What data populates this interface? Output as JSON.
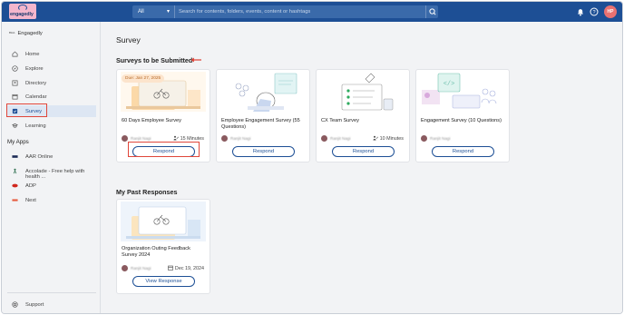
{
  "app": {
    "logo_text": "engagedly",
    "search": {
      "scope": "All",
      "placeholder": "Search for contents, folders, events, content or hashtags"
    },
    "user_initials": "HP"
  },
  "sidebar": {
    "company": "Engagedly",
    "company_mini": "ᴱᴺᴳᴬ",
    "items": [
      {
        "label": "Home",
        "icon": "home-icon"
      },
      {
        "label": "Explore",
        "icon": "compass-icon"
      },
      {
        "label": "Directory",
        "icon": "directory-icon"
      },
      {
        "label": "Calendar",
        "icon": "calendar-icon"
      },
      {
        "label": "Survey",
        "icon": "survey-icon",
        "active": true
      },
      {
        "label": "Learning",
        "icon": "learning-icon"
      }
    ],
    "my_apps_title": "My Apps",
    "apps": [
      {
        "label": "AAR Online",
        "icon": "aar-icon"
      },
      {
        "label": "Accolade - Free help with health ...",
        "icon": "accolade-icon"
      },
      {
        "label": "ADP",
        "icon": "adp-icon"
      },
      {
        "label": "Next",
        "icon": "next-icon"
      }
    ],
    "support": "Support"
  },
  "main": {
    "page_title": "Survey",
    "to_submit_title": "Surveys to be Submitted",
    "past_title": "My Past Responses",
    "surveys": [
      {
        "due": "Due: Jan 27, 2025",
        "title": "60 Days Employee Survey",
        "person": "Ranjit Nagi",
        "duration": "15 Minutes",
        "button": "Respond"
      },
      {
        "title": "Employee Engagement Survey (55 Questions)",
        "person": "Ranjit Nagi",
        "duration": "",
        "button": "Respond"
      },
      {
        "title": "CX Team Survey",
        "person": "Ranjit Nagi",
        "duration": "10 Minutes",
        "button": "Respond"
      },
      {
        "title": "Engagement Survey (10 Questions)",
        "person": "Ranjit Nagi",
        "duration": "",
        "button": "Respond"
      }
    ],
    "past": [
      {
        "title": "Organization Outing Feedback Survey 2024",
        "person": "Ranjit Nagi",
        "date": "Dec 19, 2024",
        "button": "View Response"
      }
    ]
  },
  "colors": {
    "brand": "#1d4f95",
    "highlight": "#e0463a",
    "avatar": "#e97171"
  }
}
